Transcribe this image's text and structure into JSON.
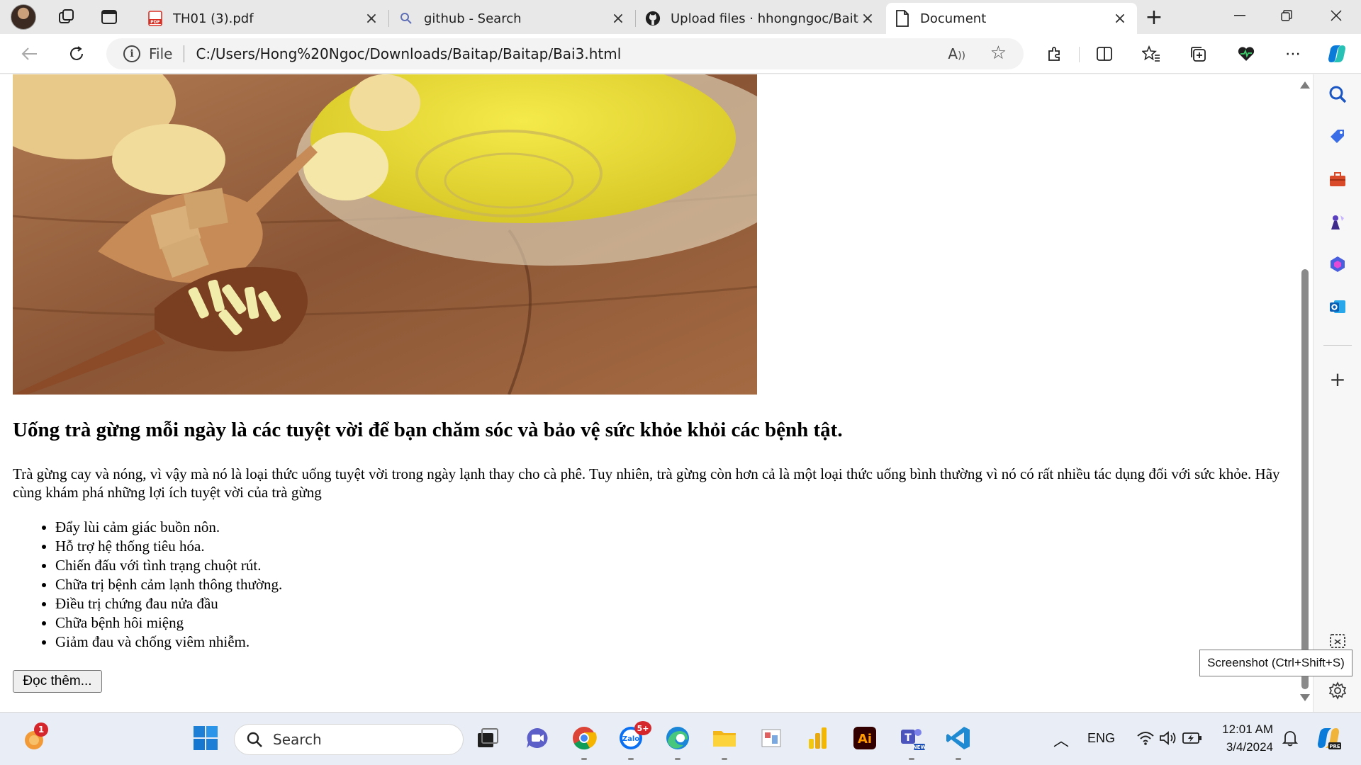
{
  "browser": {
    "tabs": [
      {
        "title": "TH01 (3).pdf",
        "icon": "pdf-icon"
      },
      {
        "title": "github - Search",
        "icon": "search-icon"
      },
      {
        "title": "Upload files · hhongngoc/Baitap",
        "icon": "github-icon"
      },
      {
        "title": "Document",
        "icon": "document-icon"
      }
    ],
    "active_tab": 3,
    "address": {
      "scheme_label": "File",
      "url": "C:/Users/Hong%20Ngoc/Downloads/Baitap/Baitap/Bai3.html"
    },
    "read_aloud": "A",
    "tooltip": "Screenshot (Ctrl+Shift+S)"
  },
  "page": {
    "heading": "Uống trà gừng mỗi ngày là các tuyệt vời để bạn chăm sóc và bảo vệ sức khỏe khỏi các bệnh tật.",
    "paragraph": "Trà gừng cay và nóng, vì vậy mà nó là loại thức uống tuyệt vời trong ngày lạnh thay cho cà phê. Tuy nhiên, trà gừng còn hơn cả là một loại thức uống bình thường vì nó có rất nhiều tác dụng đối với sức khỏe. Hãy cùng khám phá những lợi ích tuyệt vời của trà gừng",
    "benefits": [
      "Đẩy lùi cảm giác buồn nôn.",
      "Hỗ trợ hệ thống tiêu hóa.",
      "Chiến đấu với tình trạng chuột rút.",
      "Chữa trị bệnh cảm lạnh thông thường.",
      "Điều trị chứng đau nửa đầu",
      "Chữa bệnh hôi miệng",
      "Giảm đau và chống viêm nhiễm."
    ],
    "read_more": "Đọc thêm..."
  },
  "taskbar": {
    "search_label": "Search",
    "notif_badge": "1",
    "zalo_badge": "5+",
    "zalo_label": "Zalo",
    "language": "ENG",
    "time": "12:01 AM",
    "date": "3/4/2024",
    "illustrator_label": "Ai",
    "teams_tag": "NEW",
    "copilot_tag": "PRE"
  },
  "colors": {
    "accent": "#0078d4",
    "pdf_red": "#d93025",
    "badge_red": "#d4262b"
  }
}
